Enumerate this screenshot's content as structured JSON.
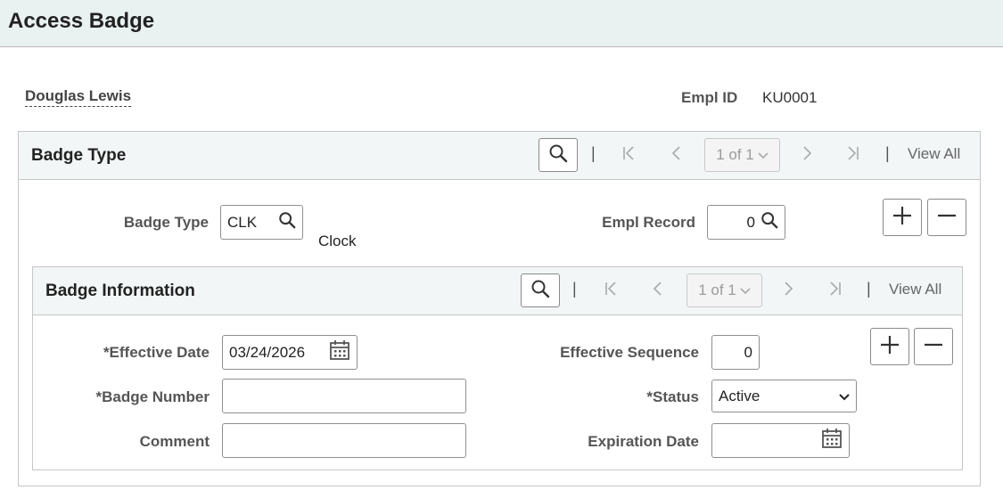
{
  "page": {
    "title": "Access Badge"
  },
  "employee": {
    "name": "Douglas Lewis",
    "emplid_label": "Empl ID",
    "emplid": "KU0001"
  },
  "badge_type_section": {
    "title": "Badge Type",
    "pager": "1 of 1",
    "view_all": "View All",
    "separator": "|",
    "badge_type_label": "Badge Type",
    "badge_type_value": "CLK",
    "badge_type_desc": "Clock",
    "empl_record_label": "Empl Record",
    "empl_record_value": "0"
  },
  "badge_info_section": {
    "title": "Badge Information",
    "pager": "1 of 1",
    "view_all": "View All",
    "separator": "|",
    "effective_date_label": "*Effective Date",
    "effective_date_value": "03/24/2026",
    "effective_seq_label": "Effective Sequence",
    "effective_seq_value": "0",
    "badge_number_label": "*Badge Number",
    "badge_number_value": "",
    "status_label": "*Status",
    "status_value": "Active",
    "comment_label": "Comment",
    "comment_value": "",
    "expiration_date_label": "Expiration Date",
    "expiration_date_value": ""
  },
  "icons": {
    "search": "search-icon",
    "first": "first-page-icon",
    "prev": "previous-icon",
    "next": "next-icon",
    "last": "last-page-icon",
    "add": "plus-icon",
    "remove": "minus-icon",
    "calendar": "calendar-icon",
    "dropdown": "chevron-down-icon"
  }
}
